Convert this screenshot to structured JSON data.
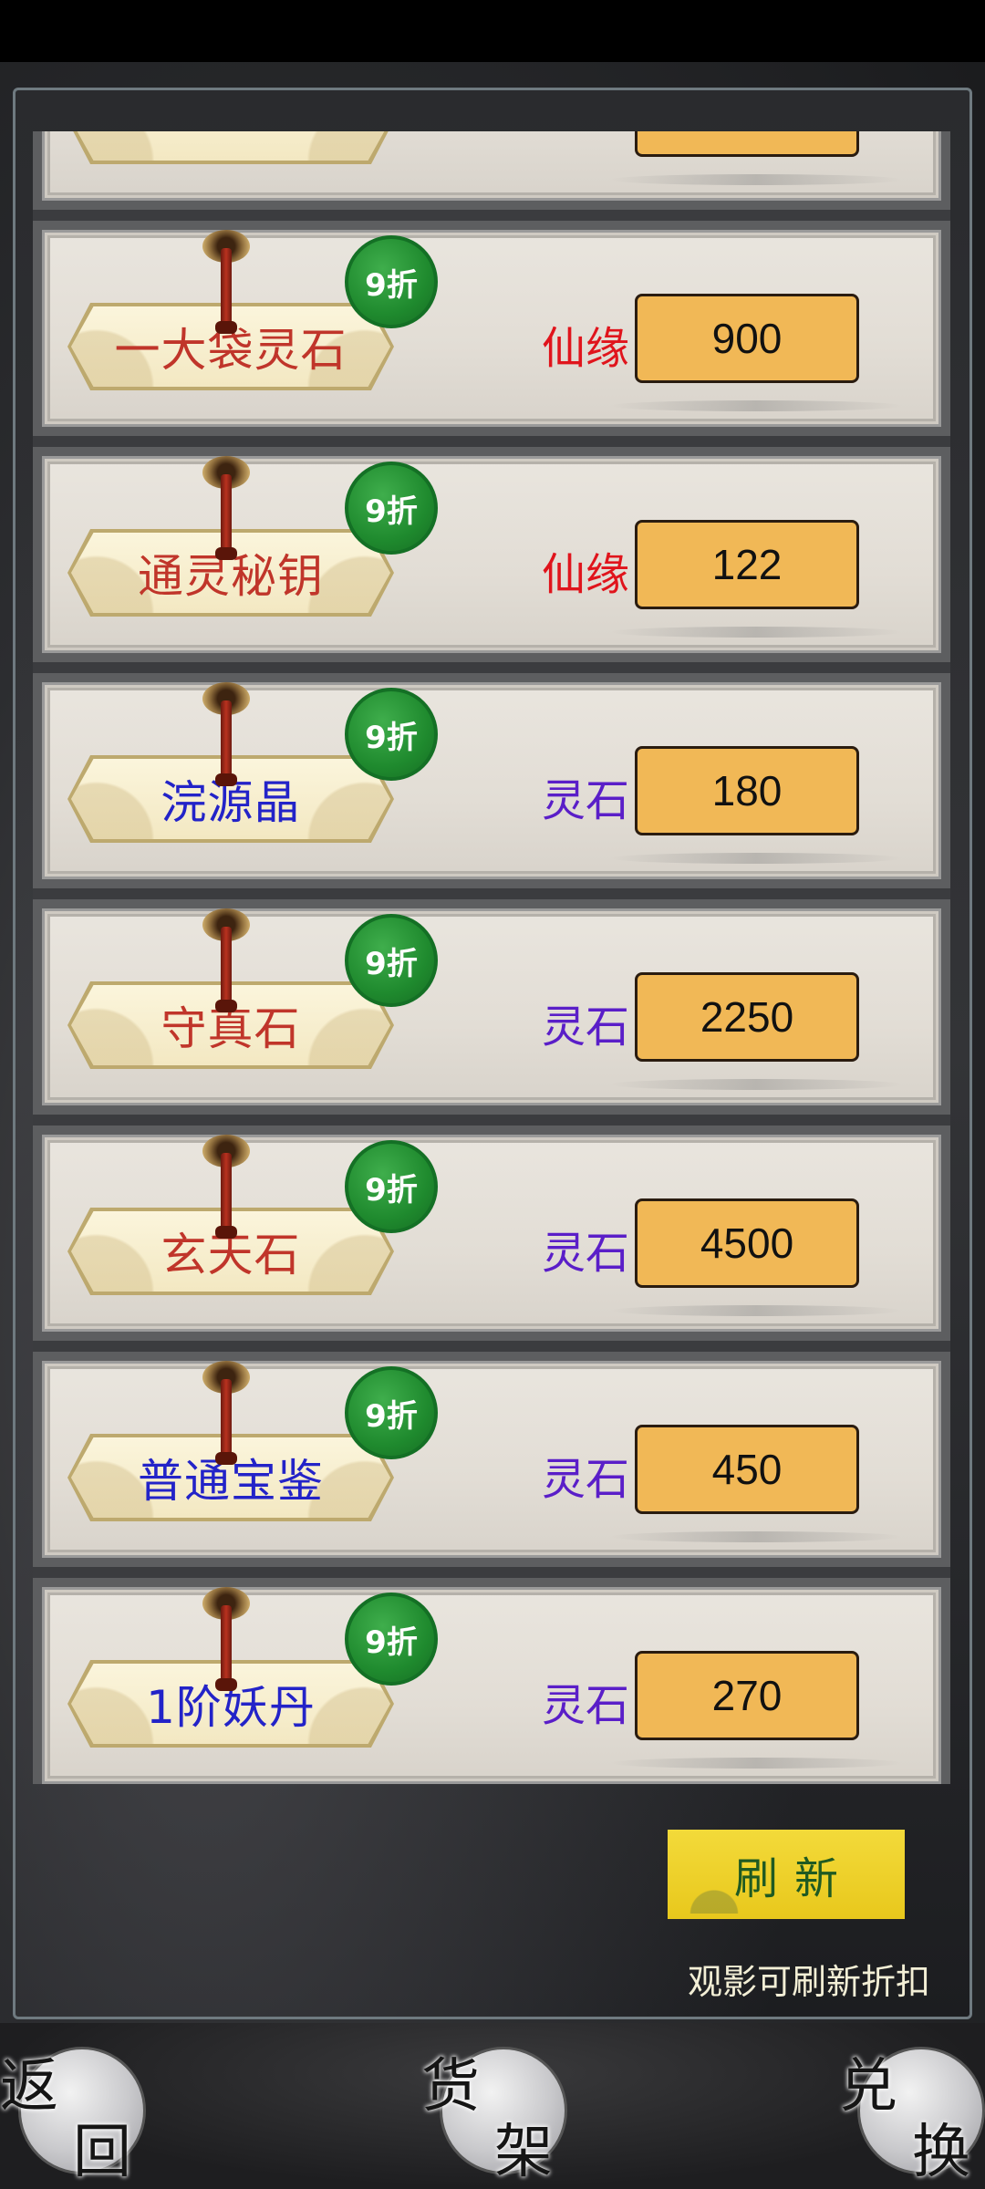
{
  "items": [
    {
      "name": "一大袋灵石",
      "name_color": "red",
      "discount": "9折",
      "currency": "仙缘",
      "currency_color": "red",
      "price": "900"
    },
    {
      "name": "通灵秘钥",
      "name_color": "red",
      "discount": "9折",
      "currency": "仙缘",
      "currency_color": "red",
      "price": "122"
    },
    {
      "name": "浣源晶",
      "name_color": "blue",
      "discount": "9折",
      "currency": "灵石",
      "currency_color": "purple",
      "price": "180"
    },
    {
      "name": "守真石",
      "name_color": "red",
      "discount": "9折",
      "currency": "灵石",
      "currency_color": "purple",
      "price": "2250"
    },
    {
      "name": "玄天石",
      "name_color": "red",
      "discount": "9折",
      "currency": "灵石",
      "currency_color": "purple",
      "price": "4500"
    },
    {
      "name": "普通宝鉴",
      "name_color": "blue",
      "discount": "9折",
      "currency": "灵石",
      "currency_color": "purple",
      "price": "450"
    },
    {
      "name": "1阶妖丹",
      "name_color": "blue",
      "discount": "9折",
      "currency": "灵石",
      "currency_color": "purple",
      "price": "270"
    }
  ],
  "refresh": {
    "label": "刷新"
  },
  "hint": "观影可刷新折扣",
  "nav": {
    "back": {
      "ch1": "返",
      "ch2": "回"
    },
    "shelf": {
      "ch1": "货",
      "ch2": "架"
    },
    "exchange": {
      "ch1": "兑",
      "ch2": "换"
    }
  },
  "colors": {
    "price_button": "#f1b856",
    "badge": "#1f8a2e",
    "refresh_button": "#e8c81c"
  }
}
